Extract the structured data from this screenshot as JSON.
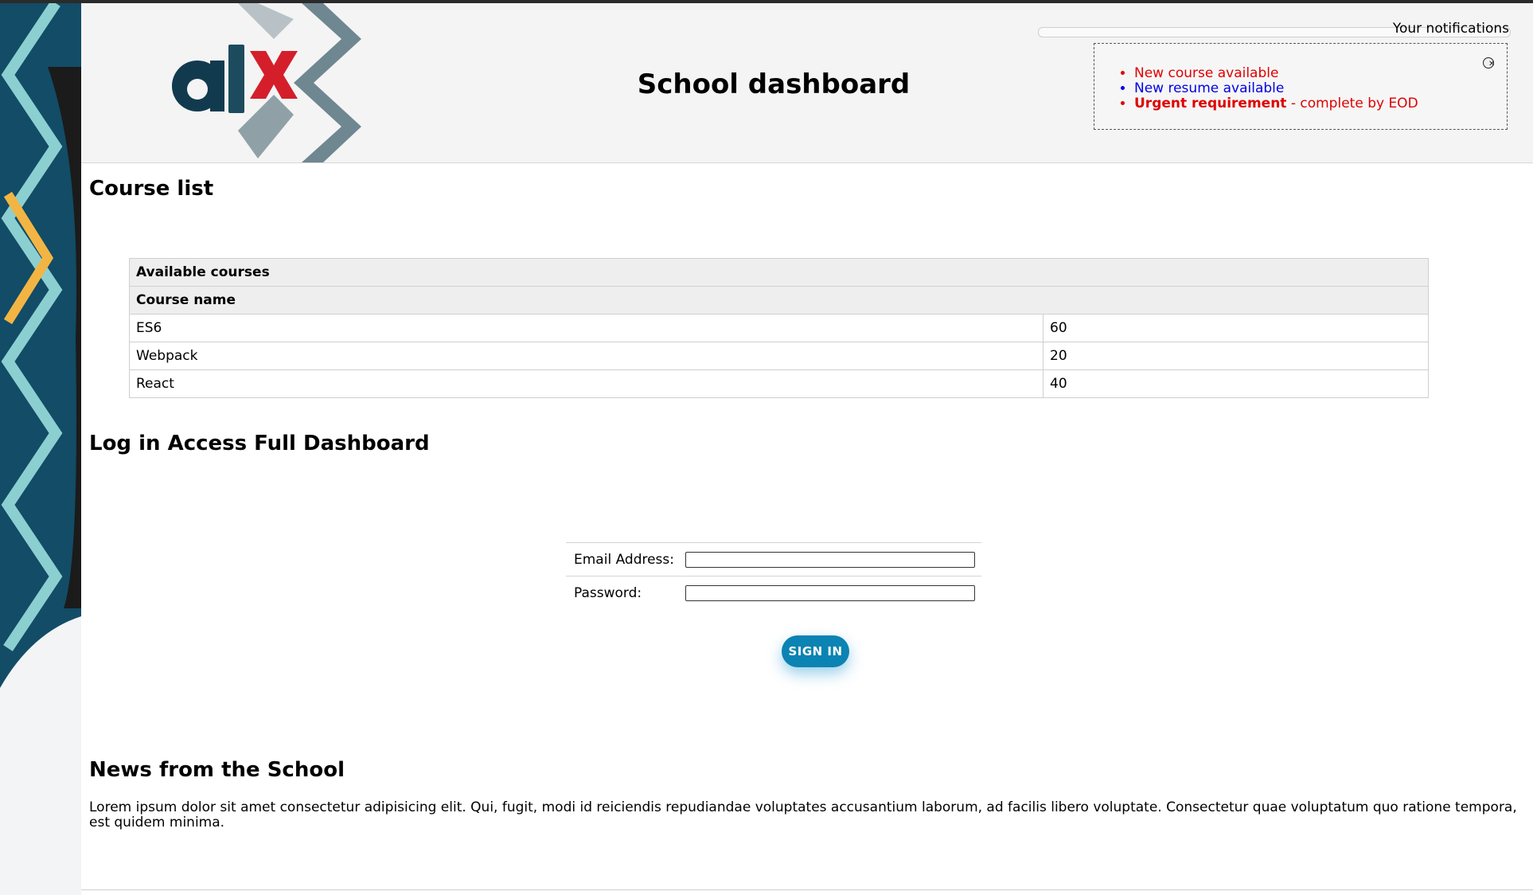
{
  "header": {
    "title": "School dashboard",
    "logo_alt": "alx"
  },
  "notifications": {
    "label": "Your notifications",
    "close_icon": "close-circle-icon",
    "items": [
      {
        "text": "New course available",
        "type": "default"
      },
      {
        "text": "New resume available",
        "type": "default-blue"
      },
      {
        "strong": "Urgent requirement",
        "text": " - complete by EOD",
        "type": "urgent"
      }
    ]
  },
  "course_list": {
    "section_title": "Course list",
    "table_title": "Available courses",
    "column_header": "Course name",
    "rows": [
      {
        "name": "ES6",
        "credit": "60"
      },
      {
        "name": "Webpack",
        "credit": "20"
      },
      {
        "name": "React",
        "credit": "40"
      }
    ]
  },
  "login": {
    "section_title": "Log in Access Full Dashboard",
    "email_label": "Email Address:",
    "email_value": "",
    "password_label": "Password:",
    "password_value": "",
    "submit_label": "SIGN IN"
  },
  "news": {
    "section_title": "News from the School",
    "text": "Lorem ipsum dolor sit amet consectetur adipisicing elit. Qui, fugit, modi id reiciendis repudiandae voluptates accusantium laborum, ad facilis libero voluptate. Consectetur quae voluptatum quo ratione tempora, est quidem minima."
  },
  "colors": {
    "header_bg": "#f4f4f4",
    "notif_red": "#e00000",
    "notif_blue": "#0000e6",
    "button": "#0b83b3",
    "logo_dark": "#123a4f",
    "logo_red": "#d41f2b"
  }
}
